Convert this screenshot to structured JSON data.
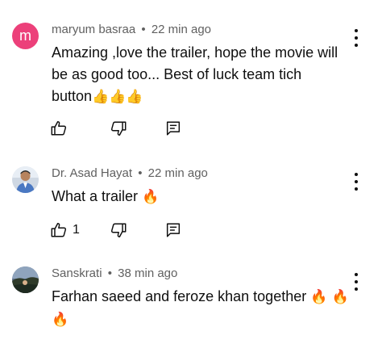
{
  "comments": [
    {
      "author": "maryum basraa",
      "time": "22 min ago",
      "avatar_letter": "m",
      "avatar_color": "#ec407a",
      "text_line1": "Amazing ,love the trailer, hope the movie will",
      "text_line2": "be as good too... Best of luck team tich",
      "text_line3": "button",
      "emoji": "👍👍👍",
      "likes": ""
    },
    {
      "author": "Dr. Asad Hayat",
      "time": "22 min ago",
      "text": "What a trailer",
      "emoji": "🔥",
      "likes": "1"
    },
    {
      "author": "Sanskrati",
      "time": "38 min ago",
      "text": "Farhan saeed and feroze khan together",
      "emoji_inline": "🔥 🔥",
      "emoji_line2": "🔥",
      "likes": ""
    }
  ],
  "meta_separator": "•",
  "icons": [
    "thumb-up-icon",
    "thumb-down-icon",
    "reply-icon",
    "more-vert-icon"
  ]
}
